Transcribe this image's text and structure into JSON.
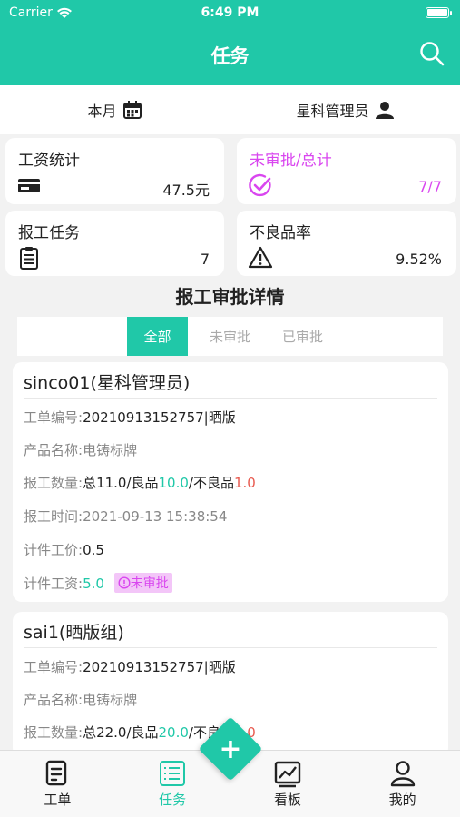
{
  "status_bar": {
    "carrier": "Carrier",
    "time": "6:49 PM"
  },
  "header": {
    "title": "任务"
  },
  "filter": {
    "period": "本月",
    "role": "星科管理员"
  },
  "stats": [
    {
      "label": "工资统计",
      "value": "47.5元",
      "icon": "wallet-icon"
    },
    {
      "label": "未审批/总计",
      "value": "7/7",
      "icon": "check-circle-icon",
      "color": "#d946ef"
    },
    {
      "label": "报工任务",
      "value": "7",
      "icon": "clipboard-icon"
    },
    {
      "label": "不良品率",
      "value": "9.52%",
      "icon": "warning-icon"
    }
  ],
  "section_title": "报工审批详情",
  "tabs": [
    "全部",
    "未审批",
    "已审批"
  ],
  "reports": [
    {
      "title": "sinco01(星科管理员)",
      "order_label": "工单编号:",
      "order_value": "20210913152757|晒版",
      "product_label": "产品名称:",
      "product_value": "电铸标牌",
      "qty_label": "报工数量:",
      "qty_total": "总11.0/良品",
      "qty_good": "10.0",
      "qty_bad_label": "/不良品",
      "qty_bad": "1.0",
      "time_label": "报工时间:",
      "time_value": "2021-09-13 15:38:54",
      "price_label": "计件工价:",
      "price_value": "0.5",
      "wage_label": "计件工资:",
      "wage_value": "5.0",
      "status": "未审批"
    },
    {
      "title": "sai1(晒版组)",
      "order_label": "工单编号:",
      "order_value": "20210913152757|晒版",
      "product_label": "产品名称:",
      "product_value": "电铸标牌",
      "qty_label": "报工数量:",
      "qty_total": "总22.0/良品",
      "qty_good": "20.0",
      "qty_bad_label": "/不良品",
      "qty_bad": "2.0"
    }
  ],
  "tabbar": [
    "工单",
    "任务",
    "看板",
    "我的"
  ],
  "colors": {
    "accent": "#20c8a8",
    "pending": "#d946ef",
    "bad": "#e85a4f"
  }
}
